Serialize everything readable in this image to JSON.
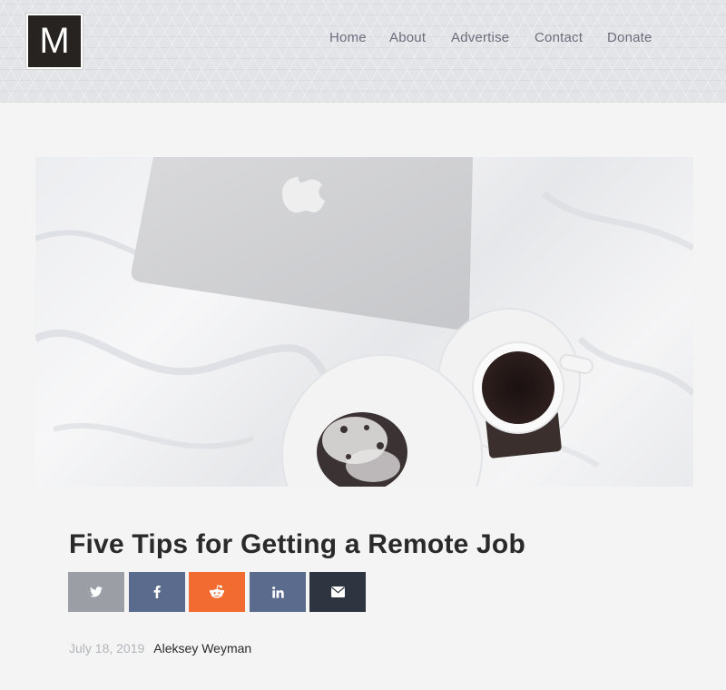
{
  "header": {
    "logo_letter": "M",
    "nav": [
      "Home",
      "About",
      "Advertise",
      "Contact",
      "Donate"
    ]
  },
  "hero": {
    "alt": "Laptop, cup of coffee and pastry on white bed sheets"
  },
  "article": {
    "title": "Five Tips for Getting a Remote Job",
    "date": "July 18, 2019",
    "author": "Aleksey Weyman"
  },
  "share": [
    {
      "network": "twitter",
      "icon": "twitter-icon",
      "color": "#9b9ea5"
    },
    {
      "network": "facebook",
      "icon": "facebook-icon",
      "color": "#5b6b8e"
    },
    {
      "network": "reddit",
      "icon": "reddit-icon",
      "color": "#f26b30"
    },
    {
      "network": "linkedin",
      "icon": "linkedin-icon",
      "color": "#5b6b8e"
    },
    {
      "network": "email",
      "icon": "envelope-icon",
      "color": "#2f3540"
    }
  ]
}
